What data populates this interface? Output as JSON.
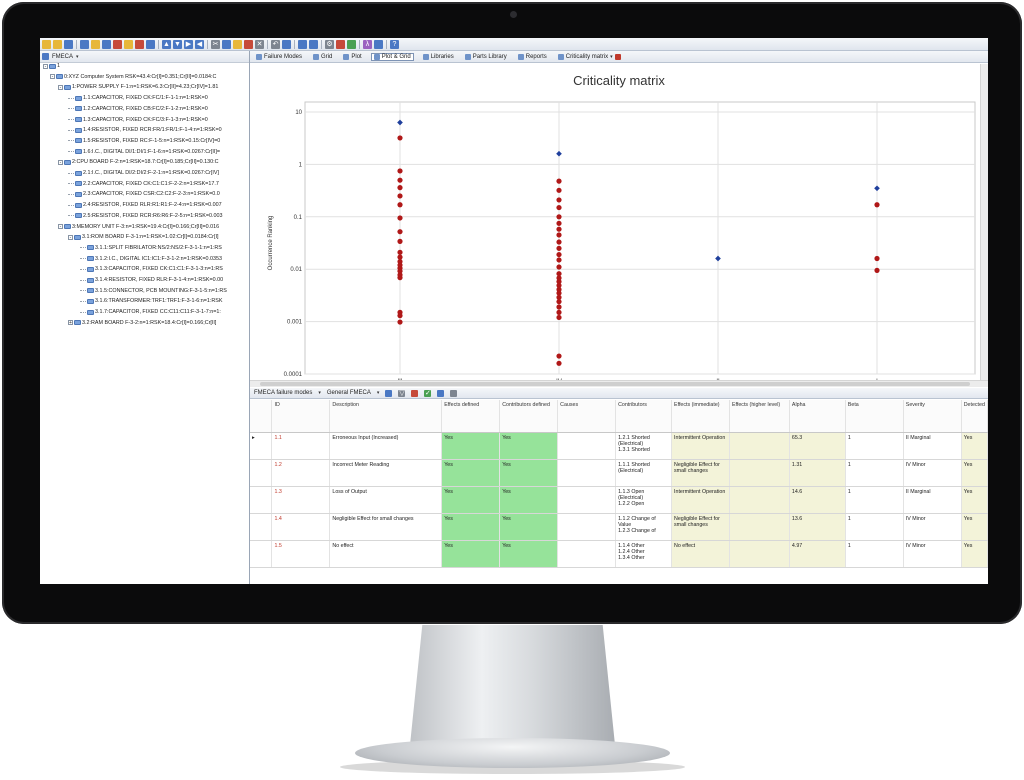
{
  "toolbar": {
    "fmeca_label": "FMECA"
  },
  "tree": [
    {
      "text": "1",
      "level": 0,
      "expander": "-"
    },
    {
      "text": "0:XYZ Computer System RSK=43.4:Cr[I]=0.351;Cr[II]=0.0184:C",
      "level": 1,
      "expander": "-"
    },
    {
      "text": "1:POWER SUPPLY F-1:n=1:RSK=6.3:Cr[II]=4.23;Cr[IV]=1.81",
      "level": 2,
      "expander": "-"
    },
    {
      "text": "1.1:CAPACITOR, FIXED CK:FC/1:F-1-1:n=1:RSK=0",
      "level": 3,
      "expander": ""
    },
    {
      "text": "1.2:CAPACITOR, FIXED CB:FC/2:F-1-2:n=1:RSK=0",
      "level": 3,
      "expander": ""
    },
    {
      "text": "1.3:CAPACITOR, FIXED CK:FC/3:F-1-3:n=1:RSK=0",
      "level": 3,
      "expander": ""
    },
    {
      "text": "1.4:RESISTOR, FIXED RCR:FR/1:FR/1:F-1-4:n=1:RSK=0",
      "level": 3,
      "expander": ""
    },
    {
      "text": "1.5:RESISTOR, FIXED RC:F-1-5:n=1:RSK=0.15:Cr[IV]=0",
      "level": 3,
      "expander": ""
    },
    {
      "text": "1.6:I.C., DIGITAL DI/1:DI/1:F-1-6:n=1:RSK=0.0267:Cr[II]=",
      "level": 3,
      "expander": ""
    },
    {
      "text": "2:CPU BOARD F-2:n=1:RSK=18.7:Cr[I]=0.185;Cr[II]=0.130:C",
      "level": 2,
      "expander": "-"
    },
    {
      "text": "2.1:I.C., DIGITAL DI/2:DI/2:F-2-1:n=1:RSK=0.0267:Cr[IV]",
      "level": 3,
      "expander": ""
    },
    {
      "text": "2.2:CAPACITOR, FIXED CK:C1:C1:F-2-2:n=1:RSK=17.7",
      "level": 3,
      "expander": ""
    },
    {
      "text": "2.3:CAPACITOR, FIXED CSR:C2:C2:F-2-3:n=1:RSK=0.0",
      "level": 3,
      "expander": ""
    },
    {
      "text": "2.4:RESISTOR, FIXED RLR:R1:R1:F-2-4:n=1:RSK=0.007",
      "level": 3,
      "expander": ""
    },
    {
      "text": "2.5:RESISTOR, FIXED RCR:R6:R6:F-2-5:n=1:RSK=0.003",
      "level": 3,
      "expander": ""
    },
    {
      "text": "3:MEMORY UNIT F-3:n=1:RSK=19.4:Cr[I]=0.166;Cr[II]=0.016",
      "level": 2,
      "expander": "-"
    },
    {
      "text": "3.1:ROM BOARD F-3-1:n=1:RSK=1.02:Cr[I]=0.0184:Cr[I]",
      "level": 3,
      "expander": "-"
    },
    {
      "text": "3.1.1:SPLIT FIBRILATOR:NS/2:NS/2:F-3-1-1:n=1:RS",
      "level": 4,
      "expander": ""
    },
    {
      "text": "3.1.2:I.C., DIGITAL IC1:IC1:F-3-1-2:n=1:RSK=0.0353",
      "level": 4,
      "expander": ""
    },
    {
      "text": "3.1.3:CAPACITOR, FIXED CK:C1:C1:F-3-1-3:n=1:RS",
      "level": 4,
      "expander": ""
    },
    {
      "text": "3.1.4:RESISTOR, FIXED RLR:F-3-1-4:n=1:RSK=0.00",
      "level": 4,
      "expander": ""
    },
    {
      "text": "3.1.5:CONNECTOR, PCB MOUNTING:F-3-1-5:n=1:RS",
      "level": 4,
      "expander": ""
    },
    {
      "text": "3.1.6:TRANSFORMER:TRF1:TRF1:F-3-1-6:n=1:RSK",
      "level": 4,
      "expander": ""
    },
    {
      "text": "3.1.7:CAPACITOR, FIXED CC:C11:C11:F-3-1-7:n=1:",
      "level": 4,
      "expander": ""
    },
    {
      "text": "3.2:RAM BOARD F-3-2:n=1:RSK=18.4:Cr[I]=0.166;Cr[II]",
      "level": 3,
      "expander": "+"
    }
  ],
  "tabs": [
    {
      "label": "Failure Modes",
      "icon": "failure-modes-icon"
    },
    {
      "label": "Grid",
      "icon": "grid-icon"
    },
    {
      "label": "Plot",
      "icon": "plot-icon"
    },
    {
      "label": "Plot & Grid",
      "icon": "plot-grid-icon",
      "active": true
    },
    {
      "label": "Libraries",
      "icon": "libraries-icon"
    },
    {
      "label": "Parts Library",
      "icon": "parts-library-icon"
    },
    {
      "label": "Reports",
      "icon": "reports-icon"
    },
    {
      "label": "Criticality matrix",
      "icon": "dropdown-icon"
    }
  ],
  "grid_toolbar": {
    "modes_label": "FMECA failure modes",
    "type_label": "General FMECA"
  },
  "chart_data": {
    "type": "scatter",
    "title": "Criticality matrix",
    "ylabel": "Occurrence Ranking",
    "xlabel": "",
    "y_scale": "log",
    "ylim": [
      0.0001,
      10
    ],
    "y_ticks": [
      "10",
      "1",
      "0.1",
      "0.01",
      "0.001",
      "0.0001"
    ],
    "categories": [
      "III",
      "IV",
      "II",
      "I"
    ],
    "grid": true,
    "colors": {
      "red": "#b01818",
      "blue": "#1f3f9c"
    },
    "series": [
      {
        "color": "red",
        "points": [
          {
            "x": "III",
            "y": 3.2
          },
          {
            "x": "III",
            "y": 0.75
          },
          {
            "x": "III",
            "y": 0.5
          },
          {
            "x": "III",
            "y": 0.36
          },
          {
            "x": "III",
            "y": 0.25
          },
          {
            "x": "III",
            "y": 0.17
          },
          {
            "x": "III",
            "y": 0.095
          },
          {
            "x": "III",
            "y": 0.052
          },
          {
            "x": "III",
            "y": 0.034
          },
          {
            "x": "III",
            "y": 0.021
          },
          {
            "x": "III",
            "y": 0.017
          },
          {
            "x": "III",
            "y": 0.014
          },
          {
            "x": "III",
            "y": 0.012
          },
          {
            "x": "III",
            "y": 0.0105
          },
          {
            "x": "III",
            "y": 0.0092
          },
          {
            "x": "III",
            "y": 0.0078
          },
          {
            "x": "III",
            "y": 0.0069
          },
          {
            "x": "III",
            "y": 0.0015
          },
          {
            "x": "III",
            "y": 0.0013
          },
          {
            "x": "III",
            "y": 0.00098
          },
          {
            "x": "IV",
            "y": 0.48
          },
          {
            "x": "IV",
            "y": 0.32
          },
          {
            "x": "IV",
            "y": 0.21
          },
          {
            "x": "IV",
            "y": 0.15
          },
          {
            "x": "IV",
            "y": 0.1
          },
          {
            "x": "IV",
            "y": 0.075
          },
          {
            "x": "IV",
            "y": 0.058
          },
          {
            "x": "IV",
            "y": 0.045
          },
          {
            "x": "IV",
            "y": 0.033
          },
          {
            "x": "IV",
            "y": 0.025
          },
          {
            "x": "IV",
            "y": 0.019
          },
          {
            "x": "IV",
            "y": 0.015
          },
          {
            "x": "IV",
            "y": 0.011
          },
          {
            "x": "IV",
            "y": 0.0082
          },
          {
            "x": "IV",
            "y": 0.0068
          },
          {
            "x": "IV",
            "y": 0.0058
          },
          {
            "x": "IV",
            "y": 0.0049
          },
          {
            "x": "IV",
            "y": 0.0041
          },
          {
            "x": "IV",
            "y": 0.0035
          },
          {
            "x": "IV",
            "y": 0.0029
          },
          {
            "x": "IV",
            "y": 0.0024
          },
          {
            "x": "IV",
            "y": 0.0019
          },
          {
            "x": "IV",
            "y": 0.0015
          },
          {
            "x": "IV",
            "y": 0.0012
          },
          {
            "x": "IV",
            "y": 0.00022
          },
          {
            "x": "IV",
            "y": 0.00016
          },
          {
            "x": "I",
            "y": 0.17
          },
          {
            "x": "I",
            "y": 0.016
          },
          {
            "x": "I",
            "y": 0.0095
          }
        ]
      },
      {
        "color": "blue",
        "points": [
          {
            "x": "III",
            "y": 6.3
          },
          {
            "x": "IV",
            "y": 1.6
          },
          {
            "x": "II",
            "y": 0.016
          },
          {
            "x": "I",
            "y": 0.35
          }
        ]
      }
    ]
  },
  "table": {
    "headers": [
      "",
      "ID",
      "Description",
      "Effects defined",
      "Contributors defined",
      "Causes",
      "Contributors",
      "Effects (immediate)",
      "Effects (higher level)",
      "Alpha",
      "Beta",
      "Severity",
      "Detected"
    ],
    "rows": [
      {
        "marker": "▸",
        "id": "1.1",
        "description": "Erroneous Input (Increased)",
        "effects_defined": "Yes",
        "contributors_defined": "Yes",
        "causes": "",
        "contributors": [
          "1.2.1 Shorted (Electrical)",
          "1.3.1 Shorted"
        ],
        "effects_immediate": "Intermittent Operation",
        "effects_higher": "",
        "alpha": "65.3",
        "beta": "1",
        "severity": "II Marginal",
        "detected": "Yes"
      },
      {
        "marker": "",
        "id": "1.2",
        "description": "Incorrect Meter Reading",
        "effects_defined": "Yes",
        "contributors_defined": "Yes",
        "causes": "",
        "contributors": [
          "1.1.1 Shorted (Electrical)"
        ],
        "effects_immediate": "Negligible Effect for small changes",
        "effects_higher": "",
        "alpha": "1.31",
        "beta": "1",
        "severity": "IV Minor",
        "detected": "Yes"
      },
      {
        "marker": "",
        "id": "1.3",
        "description": "Loss of Output",
        "effects_defined": "Yes",
        "contributors_defined": "Yes",
        "causes": "",
        "contributors": [
          "1.1.3 Open (Electrical)",
          "1.2.2 Open"
        ],
        "effects_immediate": "Intermittent Operation",
        "effects_higher": "",
        "alpha": "14.6",
        "beta": "1",
        "severity": "II Marginal",
        "detected": "Yes"
      },
      {
        "marker": "",
        "id": "1.4",
        "description": "Negligible Effect for small changes",
        "effects_defined": "Yes",
        "contributors_defined": "Yes",
        "causes": "",
        "contributors": [
          "1.1.2 Change of Value",
          "1.2.3 Change of"
        ],
        "effects_immediate": "Negligible Effect for small changes",
        "effects_higher": "",
        "alpha": "13.6",
        "beta": "1",
        "severity": "IV Minor",
        "detected": "Yes"
      },
      {
        "marker": "",
        "id": "1.5",
        "description": "No effect",
        "effects_defined": "Yes",
        "contributors_defined": "Yes",
        "causes": "",
        "contributors": [
          "1.1.4 Other",
          "1.2.4 Other",
          "1.3.4 Other"
        ],
        "effects_immediate": "No effect",
        "effects_higher": "",
        "alpha": "4.97",
        "beta": "1",
        "severity": "IV Minor",
        "detected": "Yes"
      }
    ]
  }
}
